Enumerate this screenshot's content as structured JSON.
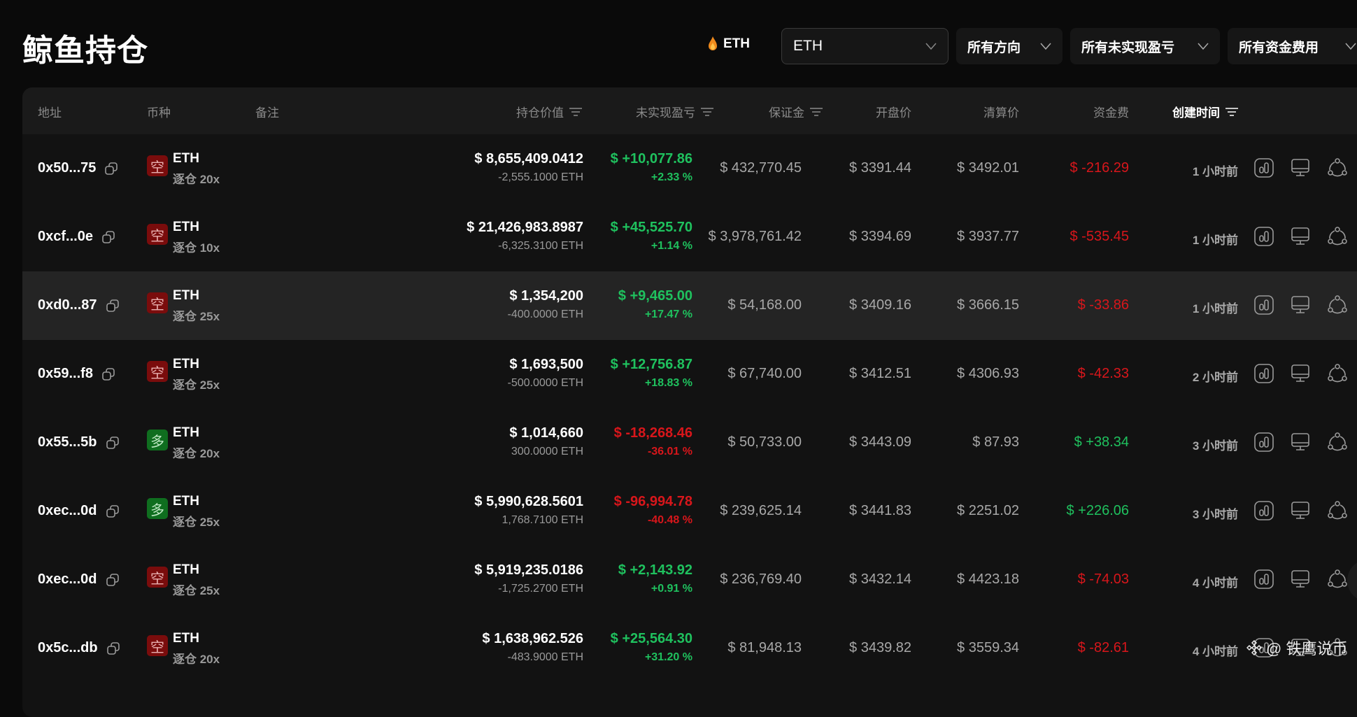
{
  "page": {
    "title": "鲸鱼持仓"
  },
  "filters": {
    "hot_coin": "ETH",
    "coin_select": "ETH",
    "direction": "所有方向",
    "pnl": "所有未实现盈亏",
    "funding": "所有资金费用"
  },
  "table": {
    "headers": {
      "address": "地址",
      "coin": "币种",
      "note": "备注",
      "position_value": "持仓价值",
      "unrealized_pnl": "未实现盈亏",
      "margin": "保证金",
      "entry_price": "开盘价",
      "liq_price": "清算价",
      "funding": "资金费",
      "created": "创建时间"
    },
    "rows": [
      {
        "address": "0x50...75",
        "side": "空",
        "side_type": "short",
        "coin": "ETH",
        "mode": "逐仓 20x",
        "value": "$ 8,655,409.0412",
        "size": "-2,555.1000 ETH",
        "pnl": "$ +10,077.86",
        "pnl_pct": "+2.33 %",
        "pnl_sign": "pos",
        "margin": "$ 432,770.45",
        "entry": "$ 3391.44",
        "liq": "$ 3492.01",
        "funding": "$ -216.29",
        "funding_sign": "neg",
        "time": "1 小时前"
      },
      {
        "address": "0xcf...0e",
        "side": "空",
        "side_type": "short",
        "coin": "ETH",
        "mode": "逐仓 10x",
        "value": "$ 21,426,983.8987",
        "size": "-6,325.3100 ETH",
        "pnl": "$ +45,525.70",
        "pnl_pct": "+1.14 %",
        "pnl_sign": "pos",
        "margin": "$ 3,978,761.42",
        "entry": "$ 3394.69",
        "liq": "$ 3937.77",
        "funding": "$ -535.45",
        "funding_sign": "neg",
        "time": "1 小时前"
      },
      {
        "address": "0xd0...87",
        "side": "空",
        "side_type": "short",
        "coin": "ETH",
        "mode": "逐仓 25x",
        "value": "$ 1,354,200",
        "size": "-400.0000 ETH",
        "pnl": "$ +9,465.00",
        "pnl_pct": "+17.47 %",
        "pnl_sign": "pos",
        "margin": "$ 54,168.00",
        "entry": "$ 3409.16",
        "liq": "$ 3666.15",
        "funding": "$ -33.86",
        "funding_sign": "neg",
        "time": "1 小时前"
      },
      {
        "address": "0x59...f8",
        "side": "空",
        "side_type": "short",
        "coin": "ETH",
        "mode": "逐仓 25x",
        "value": "$ 1,693,500",
        "size": "-500.0000 ETH",
        "pnl": "$ +12,756.87",
        "pnl_pct": "+18.83 %",
        "pnl_sign": "pos",
        "margin": "$ 67,740.00",
        "entry": "$ 3412.51",
        "liq": "$ 4306.93",
        "funding": "$ -42.33",
        "funding_sign": "neg",
        "time": "2 小时前"
      },
      {
        "address": "0x55...5b",
        "side": "多",
        "side_type": "long",
        "coin": "ETH",
        "mode": "逐仓 20x",
        "value": "$ 1,014,660",
        "size": "300.0000 ETH",
        "pnl": "$ -18,268.46",
        "pnl_pct": "-36.01 %",
        "pnl_sign": "neg",
        "margin": "$ 50,733.00",
        "entry": "$ 3443.09",
        "liq": "$ 87.93",
        "funding": "$ +38.34",
        "funding_sign": "pos",
        "time": "3 小时前"
      },
      {
        "address": "0xec...0d",
        "side": "多",
        "side_type": "long",
        "coin": "ETH",
        "mode": "逐仓 25x",
        "value": "$ 5,990,628.5601",
        "size": "1,768.7100 ETH",
        "pnl": "$ -96,994.78",
        "pnl_pct": "-40.48 %",
        "pnl_sign": "neg",
        "margin": "$ 239,625.14",
        "entry": "$ 3441.83",
        "liq": "$ 2251.02",
        "funding": "$ +226.06",
        "funding_sign": "pos",
        "time": "3 小时前"
      },
      {
        "address": "0xec...0d",
        "side": "空",
        "side_type": "short",
        "coin": "ETH",
        "mode": "逐仓 25x",
        "value": "$ 5,919,235.0186",
        "size": "-1,725.2700 ETH",
        "pnl": "$ +2,143.92",
        "pnl_pct": "+0.91 %",
        "pnl_sign": "pos",
        "margin": "$ 236,769.40",
        "entry": "$ 3432.14",
        "liq": "$ 4423.18",
        "funding": "$ -74.03",
        "funding_sign": "neg",
        "time": "4 小时前"
      },
      {
        "address": "0x5c...db",
        "side": "空",
        "side_type": "short",
        "coin": "ETH",
        "mode": "逐仓 20x",
        "value": "$ 1,638,962.526",
        "size": "-483.9000 ETH",
        "pnl": "$ +25,564.30",
        "pnl_pct": "+31.20 %",
        "pnl_sign": "pos",
        "margin": "$ 81,948.13",
        "entry": "$ 3439.82",
        "liq": "$ 3559.34",
        "funding": "$ -82.61",
        "funding_sign": "neg",
        "time": "4 小时前"
      }
    ]
  },
  "watermark": "@ 铁鹰说币",
  "colors": {
    "positive": "#1fc15e",
    "negative": "#d8161b",
    "short_badge": "#7a0c0c",
    "long_badge": "#0f6e1f"
  }
}
